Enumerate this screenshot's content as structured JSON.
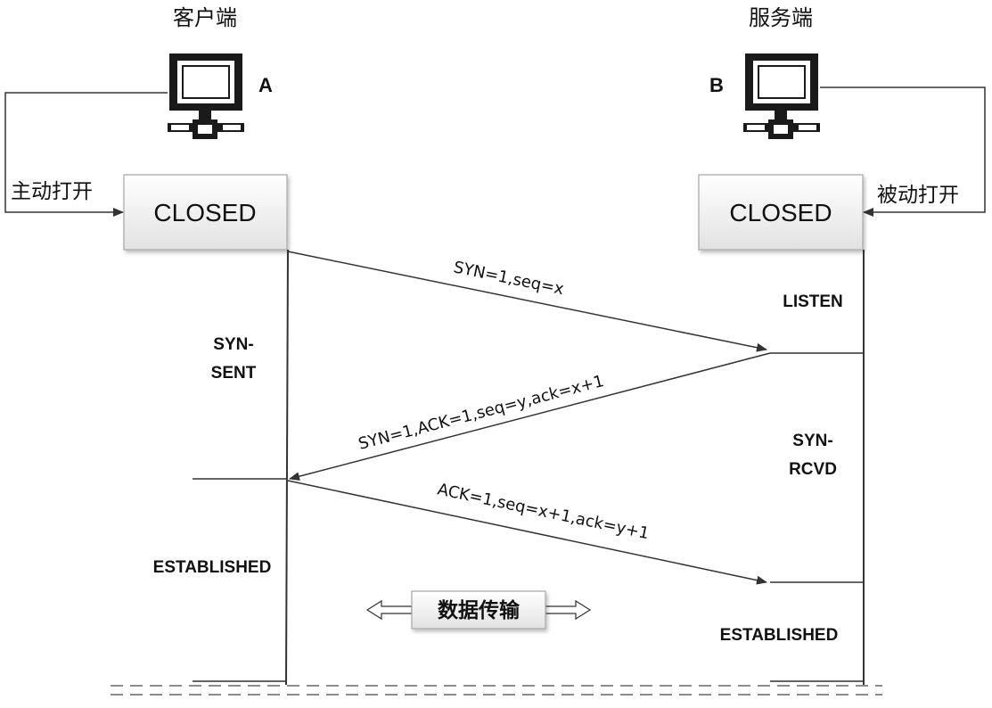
{
  "client": {
    "title": "客户端",
    "host": "A",
    "box_state": "CLOSED",
    "open_action": "主动打开"
  },
  "server": {
    "title": "服务端",
    "host": "B",
    "box_state": "CLOSED",
    "open_action": "被动打开"
  },
  "states": {
    "server_listen": "LISTEN",
    "client_syn_sent_1": "SYN-",
    "client_syn_sent_2": "SENT",
    "server_syn_rcvd_1": "SYN-",
    "server_syn_rcvd_2": "RCVD",
    "client_established": "ESTABLISHED",
    "server_established": "ESTABLISHED"
  },
  "messages": {
    "msg1": "SYN=1,seq=x",
    "msg2": "SYN=1,ACK=1,seq=y,ack=x+1",
    "msg3": "ACK=1,seq=x+1,ack=y+1"
  },
  "data_transfer": "数据传输",
  "colors": {
    "line": "#333333",
    "box_top": "#ffffff",
    "box_bottom": "#e4e4e4",
    "box_border": "#a6a6a6",
    "computer": "#1a1a1a"
  }
}
